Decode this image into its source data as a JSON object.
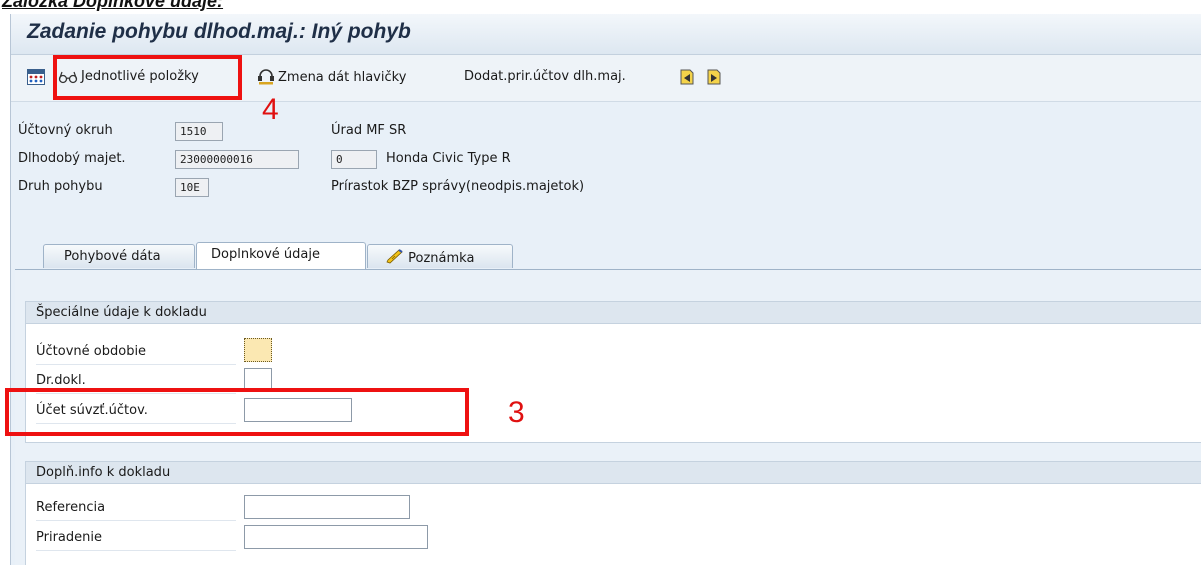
{
  "doc_heading": "Záložka Doplnkové údaje:",
  "window": {
    "title": "Zadanie pohybu dlhod.maj.: Iný pohyb"
  },
  "toolbar": {
    "items": [
      {
        "label": "",
        "icon": "grid-overview-icon"
      },
      {
        "label": "Jednotlivé položky",
        "icon": "glasses-icon"
      },
      {
        "label": "Zmena dát hlavičky",
        "icon": "header-change-icon"
      },
      {
        "label": "Dodat.prir.účtov dlh.maj.",
        "icon": ""
      },
      {
        "label": "",
        "icon": "previous-page-icon"
      },
      {
        "label": "",
        "icon": "next-page-icon"
      }
    ]
  },
  "header": {
    "company": {
      "label": "Účtovný okruh",
      "value": "1510",
      "text": "Úrad MF SR"
    },
    "asset": {
      "label": "Dlhodobý majet.",
      "value": "23000000016",
      "sub": "0",
      "text": "Honda Civic Type R"
    },
    "movement": {
      "label": "Druh pohybu",
      "value": "10E",
      "text": "Prírastok BZP správy(neodpis.majetok)"
    }
  },
  "tabs": [
    {
      "label": "Pohybové dáta",
      "active": false
    },
    {
      "label": "Doplnkové údaje",
      "active": true
    },
    {
      "label": "Poznámka",
      "active": false,
      "icon": "pencil-note-icon"
    }
  ],
  "group_special": {
    "title": "Špeciálne údaje k dokladu",
    "fields": [
      {
        "label": "Účtovné obdobie",
        "value": ""
      },
      {
        "label": "Dr.dokl.",
        "value": ""
      },
      {
        "label": "Účet súvzť.účtov.",
        "value": ""
      }
    ]
  },
  "group_info": {
    "title": "Doplň.info k dokladu",
    "fields": [
      {
        "label": "Referencia",
        "value": ""
      },
      {
        "label": "Priradenie",
        "value": ""
      }
    ]
  },
  "annotations": [
    {
      "number": "4",
      "color": "#ee1111"
    },
    {
      "number": "3",
      "color": "#ee1111"
    }
  ]
}
